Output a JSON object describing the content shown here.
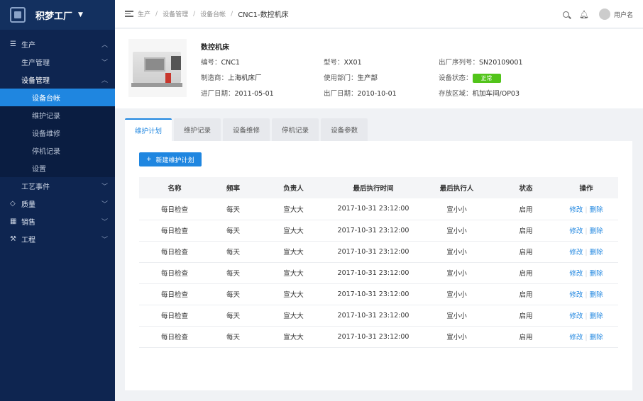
{
  "brand": {
    "name": "积梦工厂"
  },
  "sidebar": {
    "groups": [
      {
        "label": "生产"
      },
      {
        "label": "质量"
      },
      {
        "label": "销售"
      },
      {
        "label": "工程"
      }
    ],
    "subs": [
      {
        "label": "生产管理"
      },
      {
        "label": "设备管理"
      },
      {
        "label": "工艺事件"
      }
    ],
    "leaves": [
      {
        "label": "设备台帐"
      },
      {
        "label": "维护记录"
      },
      {
        "label": "设备维修"
      },
      {
        "label": "停机记录"
      },
      {
        "label": "设置"
      }
    ]
  },
  "header": {
    "breadcrumbs": [
      "生产",
      "设备管理",
      "设备台帐",
      "CNC1-数控机床"
    ],
    "username": "用户名"
  },
  "device": {
    "title": "数控机床",
    "code_label": "编号：",
    "code": "CNC1",
    "model_label": "型号：",
    "model": "XX01",
    "serial_label": "出厂序列号：",
    "serial": "SN20109001",
    "maker_label": "制造商：",
    "maker": "上海机床厂",
    "dept_label": "使用部门：",
    "dept": "生产部",
    "status_label": "设备状态：",
    "status": "正常",
    "in_date_label": "进厂日期：",
    "in_date": "2011-05-01",
    "out_date_label": "出厂日期：",
    "out_date": "2010-10-01",
    "area_label": "存放区域：",
    "area": "机加车间/OP03"
  },
  "tabs": [
    "维护计划",
    "维护记录",
    "设备维修",
    "停机记录",
    "设备参数"
  ],
  "toolbar": {
    "new_label": "新建维护计划"
  },
  "table": {
    "columns": [
      "名称",
      "频率",
      "负责人",
      "最后执行时间",
      "最后执行人",
      "状态",
      "操作"
    ],
    "edit_label": "修改",
    "delete_label": "删除",
    "rows": [
      [
        "每日检查",
        "每天",
        "宣大大",
        "2017-10-31  23:12:00",
        "宣小小",
        "启用"
      ],
      [
        "每日检查",
        "每天",
        "宣大大",
        "2017-10-31  23:12:00",
        "宣小小",
        "启用"
      ],
      [
        "每日检查",
        "每天",
        "宣大大",
        "2017-10-31  23:12:00",
        "宣小小",
        "启用"
      ],
      [
        "每日检查",
        "每天",
        "宣大大",
        "2017-10-31  23:12:00",
        "宣小小",
        "启用"
      ],
      [
        "每日检查",
        "每天",
        "宣大大",
        "2017-10-31  23:12:00",
        "宣小小",
        "启用"
      ],
      [
        "每日检查",
        "每天",
        "宣大大",
        "2017-10-31  23:12:00",
        "宣小小",
        "启用"
      ],
      [
        "每日检查",
        "每天",
        "宣大大",
        "2017-10-31  23:12:00",
        "宣小小",
        "启用"
      ]
    ]
  },
  "colors": {
    "accent": "#1f86e0",
    "sidebar": "#0e2550",
    "status_ok": "#52c41a"
  }
}
